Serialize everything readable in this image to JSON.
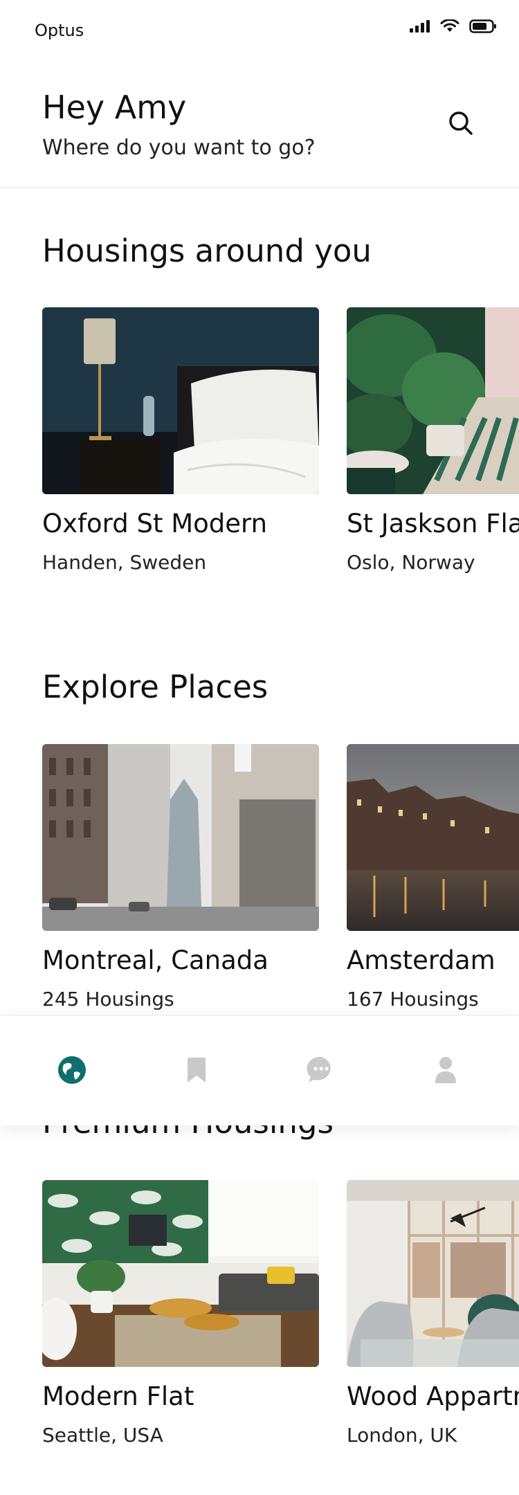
{
  "status_bar": {
    "carrier": "Optus",
    "icons": [
      "signal-icon",
      "wifi-icon",
      "battery-icon"
    ]
  },
  "header": {
    "greeting": "Hey Amy",
    "subtitle": "Where do you want to go?",
    "search_icon": "search-icon"
  },
  "sections": {
    "housings": {
      "title": "Housings around you",
      "cards": [
        {
          "title": "Oxford St Modern",
          "subtitle": "Handen, Sweden"
        },
        {
          "title": "St Jaskson Flat",
          "subtitle": "Oslo, Norway"
        }
      ]
    },
    "explore": {
      "title": "Explore Places",
      "cards": [
        {
          "title": "Montreal, Canada",
          "subtitle": "245 Housings"
        },
        {
          "title": "Amsterdam",
          "subtitle": "167 Housings"
        }
      ]
    },
    "premium": {
      "title": "Premium Housings",
      "cards": [
        {
          "title": "Modern Flat",
          "subtitle": "Seattle, USA"
        },
        {
          "title": "Wood Appartment",
          "subtitle": "London, UK"
        }
      ]
    }
  },
  "bottom_nav": {
    "items": [
      {
        "icon": "globe-icon",
        "active": true
      },
      {
        "icon": "bookmark-icon",
        "active": false
      },
      {
        "icon": "chat-icon",
        "active": false
      },
      {
        "icon": "profile-icon",
        "active": false
      }
    ]
  },
  "colors": {
    "accent": "#0f6e6e",
    "inactive_icon": "#c9c9c9",
    "text": "#111111"
  }
}
